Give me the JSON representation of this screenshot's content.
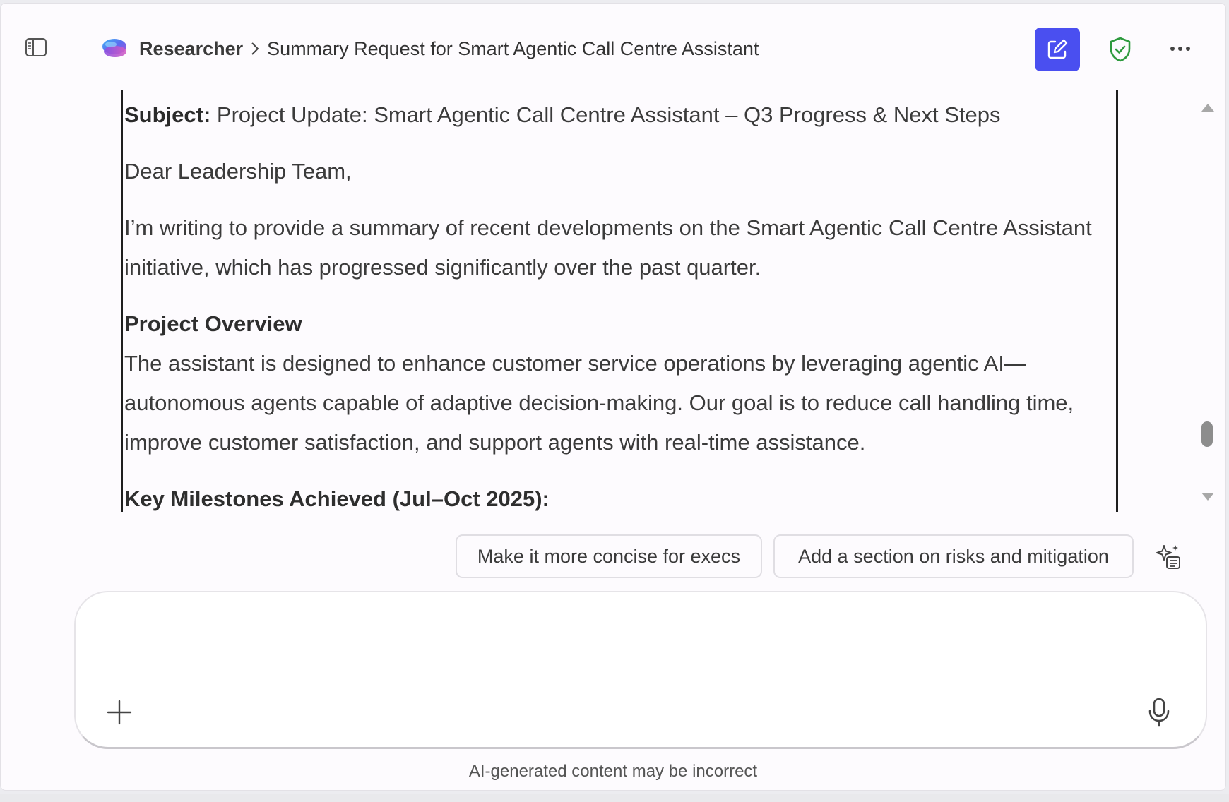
{
  "header": {
    "app_name": "Researcher",
    "page_title": "Summary Request for Smart Agentic Call Centre Assistant",
    "accent_color": "#4a4ff0",
    "shield_color": "#2e9a3e"
  },
  "document": {
    "subject_label": "Subject:",
    "subject_text": " Project Update: Smart Agentic Call Centre Assistant – Q3 Progress & Next Steps",
    "greeting": "Dear Leadership Team,",
    "intro": "I’m writing to provide a summary of recent developments on the Smart Agentic Call Centre Assistant initiative, which has progressed significantly over the past quarter.",
    "overview_title": "Project Overview",
    "overview_text": "The assistant is designed to enhance customer service operations by leveraging agentic AI—autonomous agents capable of adaptive decision-making. Our goal is to reduce call handling time, improve customer satisfaction, and support agents with real-time assistance.",
    "milestones_title": "Key Milestones Achieved (Jul–Oct 2025):"
  },
  "suggestions": [
    {
      "label": "Make it more concise for execs"
    },
    {
      "label": "Add a section on risks and mitigation"
    }
  ],
  "composer": {
    "value": "",
    "placeholder": ""
  },
  "footer": {
    "disclaimer": "AI-generated content may be incorrect"
  },
  "icons": {
    "sidebar": "sidebar-toggle-icon",
    "logo": "researcher-logo",
    "new_chat": "compose-icon",
    "shield": "shield-check-icon",
    "more": "more-horizontal-icon",
    "sparkle": "sparkle-list-icon",
    "add": "plus-icon",
    "mic": "microphone-icon"
  }
}
